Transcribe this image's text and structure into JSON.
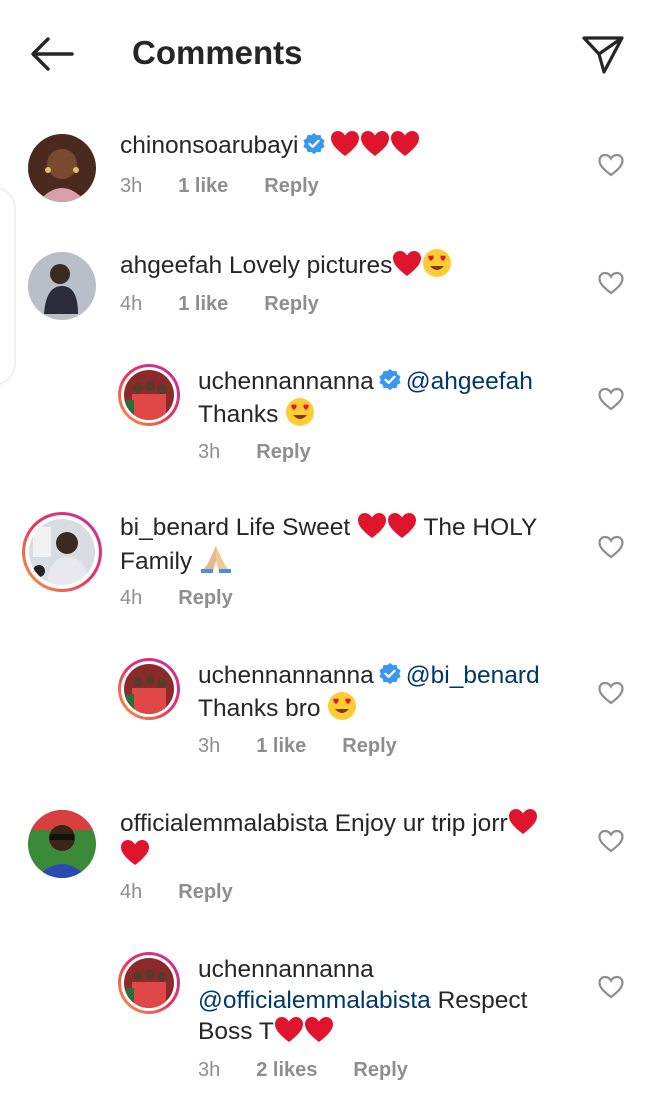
{
  "header": {
    "title": "Comments"
  },
  "comments": [
    {
      "username": "chinonsoarubayi",
      "verified": true,
      "text": "",
      "time": "3h",
      "likes": "1 like",
      "reply_label": "Reply"
    },
    {
      "username": "ahgeefah",
      "verified": false,
      "text": "Lovely pictures",
      "time": "4h",
      "likes": "1 like",
      "reply_label": "Reply"
    },
    {
      "username": "uchennannanna",
      "verified": true,
      "mention": "@ahgeefah",
      "text": "Thanks",
      "time": "3h",
      "likes": "",
      "reply_label": "Reply"
    },
    {
      "username": "bi_benard",
      "verified": false,
      "text_a": "Life Sweet",
      "text_b": "The HOLY",
      "text_c": "Family",
      "time": "4h",
      "likes": "",
      "reply_label": "Reply"
    },
    {
      "username": "uchennannanna",
      "verified": true,
      "mention": "@bi_benard",
      "text": "Thanks bro",
      "time": "3h",
      "likes": "1 like",
      "reply_label": "Reply"
    },
    {
      "username": "officialemmalabista",
      "verified": false,
      "text": "Enjoy ur trip jorr",
      "time": "4h",
      "likes": "",
      "reply_label": "Reply"
    },
    {
      "username": "uchennannanna",
      "verified": false,
      "mention": "@officialemmalabista",
      "text_a": "Respect",
      "text_b": "Boss T",
      "time": "3h",
      "likes": "2 likes",
      "reply_label": "Reply"
    }
  ],
  "icons": {
    "back": "arrow-left-icon",
    "share": "paper-plane-icon",
    "like": "heart-outline-icon",
    "verified": "verified-badge-icon"
  },
  "colors": {
    "text": "#262626",
    "meta": "#8e8e8e",
    "mention": "#00376b",
    "verified": "#3897f0",
    "heart": "#e0152d"
  }
}
